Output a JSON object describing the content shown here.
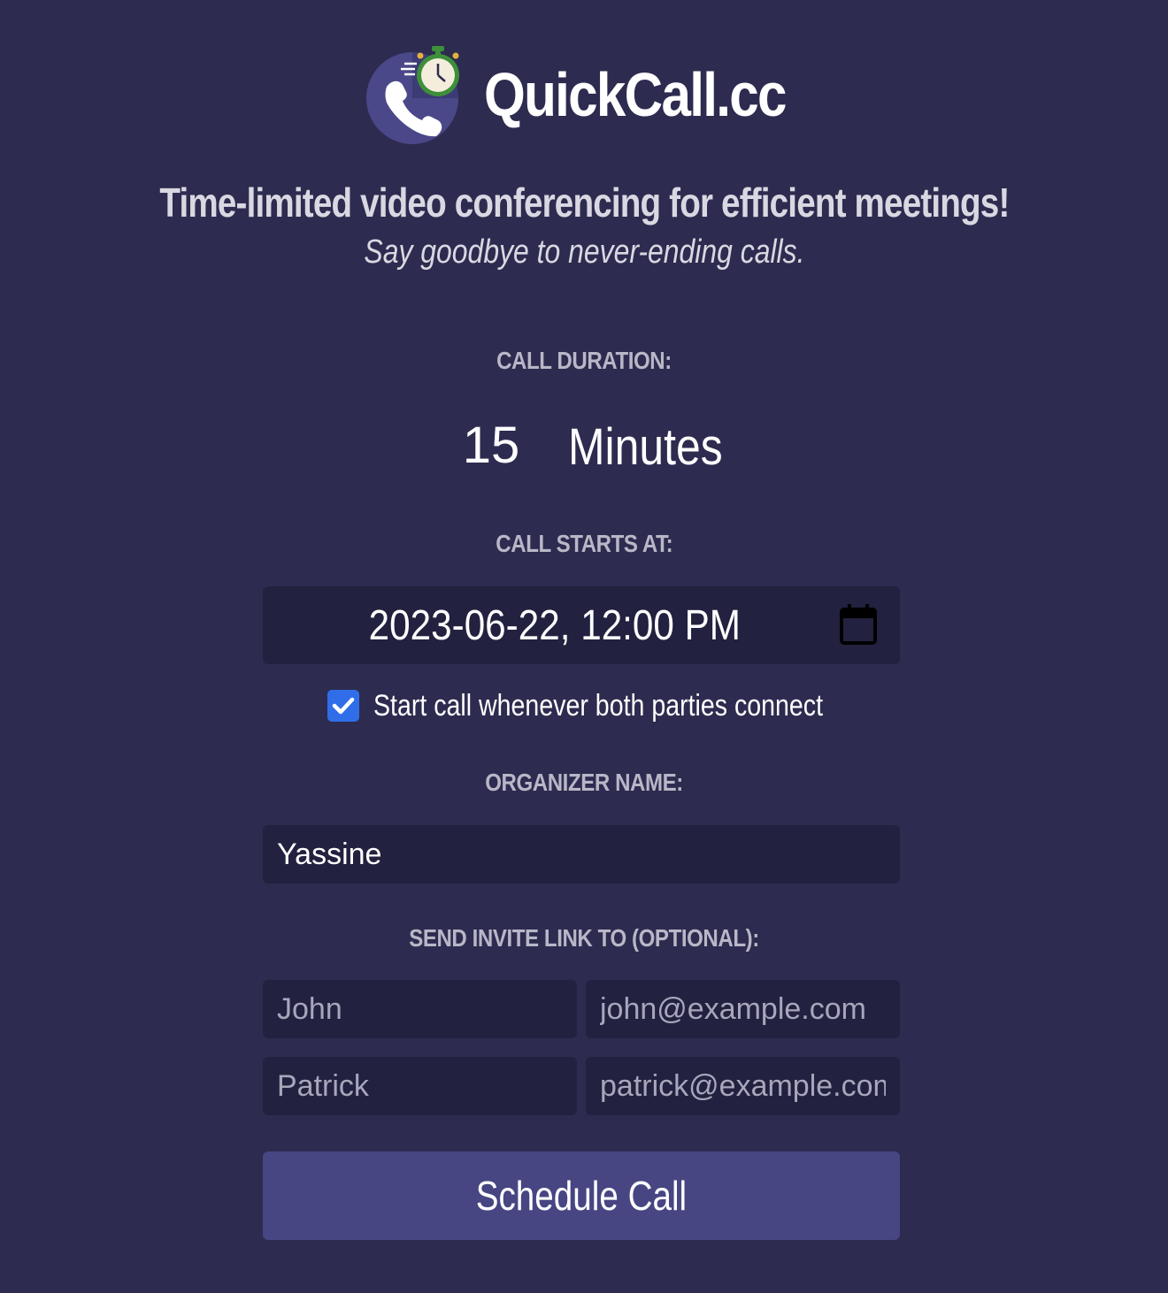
{
  "header": {
    "app_title": "QuickCall.cc",
    "tagline": "Time-limited video conferencing for efficient meetings!",
    "subtagline": "Say goodbye to never-ending calls."
  },
  "duration": {
    "label": "CALL DURATION:",
    "value": "15",
    "unit": "Minutes"
  },
  "start": {
    "label": "CALL STARTS AT:",
    "datetime": "2023-06-22, 12:00 PM",
    "checkbox_label": "Start call whenever both parties connect",
    "checkbox_checked": true
  },
  "organizer": {
    "label": "ORGANIZER NAME:",
    "value": "Yassine"
  },
  "invite": {
    "label": "SEND INVITE LINK TO (OPTIONAL):",
    "rows": [
      {
        "name_placeholder": "John",
        "email_placeholder": "john@example.com"
      },
      {
        "name_placeholder": "Patrick",
        "email_placeholder": "patrick@example.com"
      }
    ]
  },
  "actions": {
    "schedule_label": "Schedule Call"
  },
  "colors": {
    "background": "#2d2b4f",
    "field": "#22213f",
    "button": "#474683",
    "checkbox": "#2f6ee8",
    "label": "#b8b7c7"
  },
  "icons": {
    "logo": "phone-stopwatch-icon",
    "calendar": "calendar-icon",
    "checkbox": "check-icon"
  }
}
